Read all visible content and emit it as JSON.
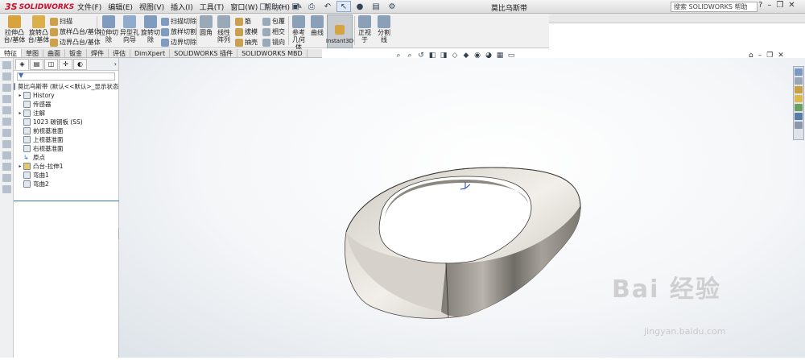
{
  "app": {
    "brand": "SOLIDWORKS",
    "brand_prefix": "3S",
    "doc_title": "莫比乌斯带",
    "search_placeholder": "搜索 SOLIDWORKS 帮助"
  },
  "menus": [
    "文件(F)",
    "编辑(E)",
    "视图(V)",
    "插入(I)",
    "工具(T)",
    "窗口(W)",
    "帮助(H)"
  ],
  "ribbon": {
    "extrude_boss": "拉伸凸台/基体",
    "revolve_boss": "旋转凸台/基体",
    "sweep": "扫描",
    "loft": "放样凸台/基体",
    "boundary": "边界凸台/基体",
    "extrude_cut": "拉伸切除",
    "hole_wizard": "异型孔向导",
    "revolve_cut": "旋转切除",
    "swept_cut": "扫描切除",
    "lofted_cut": "放样切割",
    "boundary_cut": "边界切除",
    "fillet": "圆角",
    "linear_pattern": "线性阵列",
    "rib": "筋",
    "draft": "拔模",
    "shell": "抽壳",
    "wrap": "包覆",
    "intersect": "相交",
    "mirror": "镜向",
    "ref_geometry": "参考几何体",
    "curves": "曲线",
    "instant3d": "Instant3D",
    "normal_to": "正视于",
    "split": "分割线"
  },
  "tabs": [
    "特征",
    "草图",
    "曲面",
    "钣金",
    "焊件",
    "评估",
    "DimXpert",
    "SOLIDWORKS 插件",
    "SOLIDWORKS MBD"
  ],
  "tree": {
    "root": "莫比乌斯带 (默认<<默认>_显示状态 1>)",
    "items": [
      "History",
      "传感器",
      "注解",
      "1023 碳钢板 (SS)",
      "前视基准面",
      "上视基准面",
      "右视基准面",
      "原点",
      "凸台-拉伸1",
      "弯曲1",
      "弯曲2"
    ]
  },
  "watermark": {
    "logo": "Bai 经验",
    "url": "jingyan.baidu.com"
  },
  "colors": {
    "brand": "#c8102e",
    "selection": "#3a6fc4",
    "part": "#9a948c"
  }
}
